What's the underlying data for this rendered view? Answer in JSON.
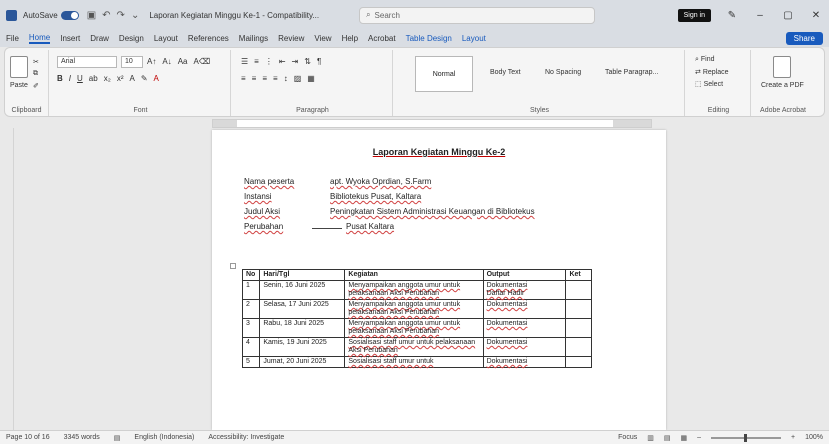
{
  "titlebar": {
    "autosave_label": "AutoSave",
    "toggle_state": "On",
    "doc_title": "Laporan Kegiatan Minggu Ke-1 - Compatibility...",
    "search_placeholder": "Search",
    "signin_label": "Sign in"
  },
  "tabs": [
    "File",
    "Home",
    "Insert",
    "Draw",
    "Design",
    "Layout",
    "References",
    "Mailings",
    "Review",
    "View",
    "Help",
    "Acrobat",
    "Table Design",
    "Layout"
  ],
  "share_label": "Share",
  "ribbon": {
    "paste": "Paste",
    "clipboard": "Clipboard",
    "font_name": "Arial",
    "font_size": "10",
    "font_group": "Font",
    "paragraph_group": "Paragraph",
    "styles": [
      "Normal",
      "Body Text",
      "No Spacing",
      "Table Paragrap..."
    ],
    "styles_group": "Styles",
    "find": "Find",
    "replace": "Replace",
    "select": "Select",
    "editing_group": "Editing",
    "create_pdf": "Create a PDF",
    "adobe_group": "Adobe Acrobat"
  },
  "document": {
    "heading": "Laporan Kegiatan Minggu Ke-2",
    "info": [
      {
        "key": "Nama peserta",
        "value": "apt. Wyoka Oprdian, S.Farm"
      },
      {
        "key": "Instansi",
        "value": "Bibliotekus Pusat, Kaltara"
      },
      {
        "key": "Judul Aksi",
        "value": "Peningkatan Sistem Administrasi Keuangan di Bibliotekus"
      },
      {
        "key": "Perubahan",
        "value": "Pusat Kaltara"
      }
    ],
    "table_headers": [
      "No",
      "Hari/Tgl",
      "Kegiatan",
      "Output",
      "Ket"
    ],
    "table_rows": [
      {
        "no": "1",
        "date": "Senin, 16 Juni 2025",
        "activity": "Menyampaikan anggota umur untuk pelaksanaan Aksi Perubahan",
        "output": "Dokumentasi\nDaftar Hadir",
        "note": ""
      },
      {
        "no": "2",
        "date": "Selasa, 17 Juni 2025",
        "activity": "Menyampaikan anggota umur untuk pelaksanaan Aksi Perubahan",
        "output": "Dokumentasi",
        "note": ""
      },
      {
        "no": "3",
        "date": "Rabu, 18 Juni 2025",
        "activity": "Menyampaikan anggota umur untuk pelaksanaan Aksi Perubahan",
        "output": "Dokumentasi",
        "note": ""
      },
      {
        "no": "4",
        "date": "Kamis, 19 Juni 2025",
        "activity": "Sosialisasi staff umur untuk pelaksanaan Aksi Perubahan",
        "output": "Dokumentasi",
        "note": ""
      },
      {
        "no": "5",
        "date": "Jumat, 20 Juni 2025",
        "activity": "Sosialisasi staff umur untuk",
        "output": "Dokumentasi",
        "note": ""
      }
    ]
  },
  "statusbar": {
    "page": "Page 10 of 16",
    "words": "3345 words",
    "language": "English (Indonesia)",
    "accessibility": "Accessibility: Investigate",
    "focus": "Focus",
    "zoom": "100%"
  }
}
